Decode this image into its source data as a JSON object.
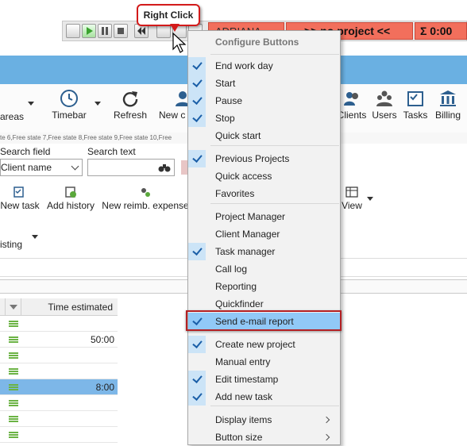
{
  "callout": {
    "text": "Right Click"
  },
  "topbar": {
    "user": "ADRIANA",
    "project": ">> no project <<",
    "total": "Σ 0:00"
  },
  "ribbon": {
    "items": [
      {
        "label": "areas"
      },
      {
        "label": "Timebar"
      },
      {
        "label": "Refresh"
      },
      {
        "label": "New c"
      },
      {
        "label": "Clients"
      },
      {
        "label": "Users"
      },
      {
        "label": "Tasks"
      },
      {
        "label": "Billing"
      }
    ],
    "state_strip": "te 6,Free state 7,Free state 8,Free state 9,Free state 10,Free"
  },
  "search": {
    "field_label": "Search field",
    "field_value": "Client name",
    "text_label": "Search text",
    "text_value": ""
  },
  "actions": {
    "new_task": "New task",
    "add_history": "Add history",
    "new_reimb": "New reimb. expense",
    "view": "View"
  },
  "listing": {
    "label": "isting"
  },
  "grid": {
    "column_header": "Time estimated",
    "rows": [
      {
        "value": ""
      },
      {
        "value": "50:00"
      },
      {
        "value": ""
      },
      {
        "value": ""
      },
      {
        "value": "8:00",
        "selected": true
      },
      {
        "value": ""
      },
      {
        "value": ""
      },
      {
        "value": ""
      }
    ]
  },
  "context_menu": {
    "title": "Configure Buttons",
    "items": [
      {
        "label": "End work day",
        "checked": true
      },
      {
        "label": "Start",
        "checked": true
      },
      {
        "label": "Pause",
        "checked": true
      },
      {
        "label": "Stop",
        "checked": true
      },
      {
        "label": "Quick start",
        "checked": false
      },
      {
        "label": "Previous Projects",
        "checked": true
      },
      {
        "label": "Quick access",
        "checked": false
      },
      {
        "label": "Favorites",
        "checked": false
      },
      {
        "label": "Project Manager",
        "checked": false
      },
      {
        "label": "Client Manager",
        "checked": false
      },
      {
        "label": "Task manager",
        "checked": true
      },
      {
        "label": "Call log",
        "checked": false
      },
      {
        "label": "Reporting",
        "checked": false
      },
      {
        "label": "Quickfinder",
        "checked": false
      },
      {
        "label": "Send e-mail report",
        "checked": true,
        "highlighted": true
      },
      {
        "label": "Create new project",
        "checked": true
      },
      {
        "label": "Manual entry",
        "checked": false
      },
      {
        "label": "Edit timestamp",
        "checked": true
      },
      {
        "label": "Add new task",
        "checked": true
      },
      {
        "label": "Display items",
        "checked": false,
        "submenu": true
      },
      {
        "label": "Button size",
        "checked": false,
        "submenu": true
      }
    ]
  },
  "colors": {
    "status_red": "#f26f5c",
    "header_blue": "#6ab0e2",
    "highlight_blue": "#91c9f7",
    "callout_red": "#d31a1a"
  }
}
